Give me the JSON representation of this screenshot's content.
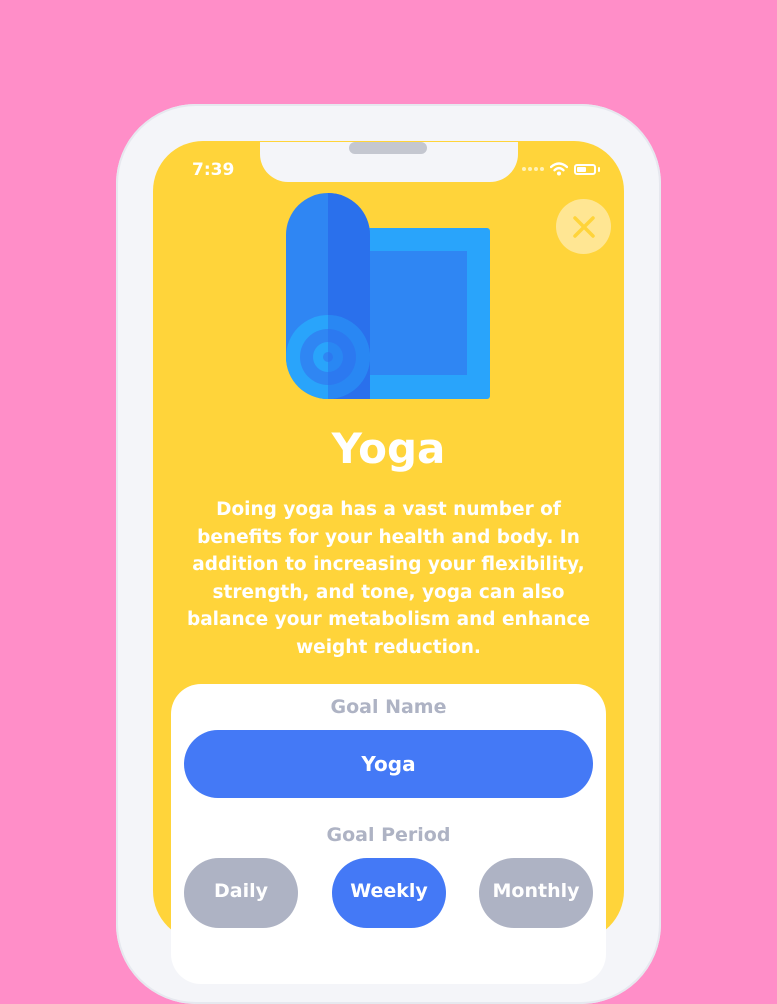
{
  "status_bar": {
    "time": "7:39"
  },
  "goal": {
    "title": "Yoga",
    "description": "Doing yoga has a vast number of benefits for your health and body. In addition to increasing your flexibility, strength, and tone, yoga can also balance your metabolism and enhance weight reduction."
  },
  "form": {
    "goal_name_label": "Goal Name",
    "goal_name_value": "Yoga",
    "goal_period_label": "Goal Period",
    "periods": [
      "Daily",
      "Weekly",
      "Monthly"
    ],
    "selected_period": "Weekly"
  },
  "colors": {
    "background": "#FF8EC8",
    "screen": "#FFD43A",
    "accent": "#4479F6",
    "inactive": "#AEB3C4"
  },
  "icons": {
    "close": "close-icon",
    "wifi": "wifi-icon",
    "battery": "battery-icon",
    "illustration": "yoga-mat-icon"
  }
}
